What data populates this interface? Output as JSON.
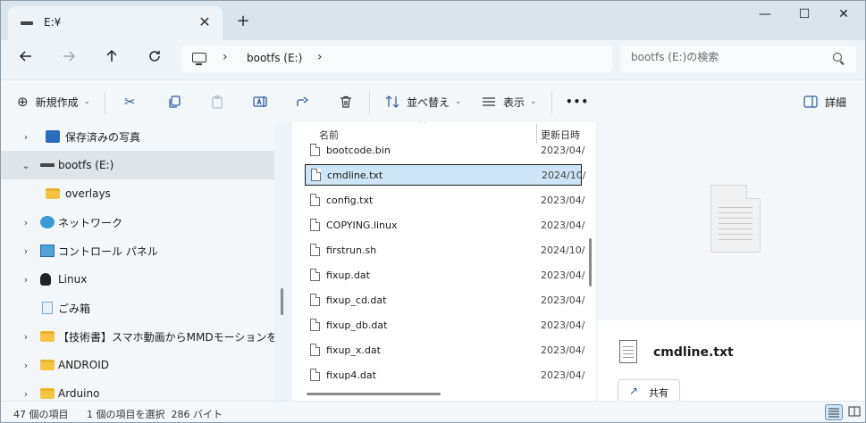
{
  "tab": {
    "title": "E:¥",
    "close_glyph": "✕",
    "new_glyph": "+"
  },
  "window": {
    "minimize": "—",
    "maximize": "☐",
    "close": "✕"
  },
  "address": {
    "crumb": "bootfs (E:)",
    "search_placeholder": "bootfs (E:)の検索"
  },
  "toolbar": {
    "new_label": "新規作成",
    "sort_label": "並べ替え",
    "view_label": "表示",
    "more_label": "•••",
    "details_label": "詳細"
  },
  "nav": {
    "items": [
      {
        "label": "保存済みの写真",
        "icon": "pictures-icon"
      },
      {
        "label": "bootfs (E:)",
        "icon": "drive-icon"
      },
      {
        "label": "overlays",
        "icon": "folder-icon"
      },
      {
        "label": "ネットワーク",
        "icon": "network-icon"
      },
      {
        "label": "コントロール パネル",
        "icon": "control-panel-icon"
      },
      {
        "label": "Linux",
        "icon": "linux-icon"
      },
      {
        "label": "ごみ箱",
        "icon": "recycle-bin-icon"
      },
      {
        "label": "【技術書】スマホ動画からMMDモーションを作る",
        "icon": "folder-icon"
      },
      {
        "label": "ANDROID",
        "icon": "folder-icon"
      },
      {
        "label": "Arduino",
        "icon": "folder-icon"
      }
    ]
  },
  "files": {
    "headers": {
      "name": "名前",
      "modified": "更新日時"
    },
    "rows": [
      {
        "name": "bootcode.bin",
        "date": "2023/04/"
      },
      {
        "name": "cmdline.txt",
        "date": "2024/10/"
      },
      {
        "name": "config.txt",
        "date": "2023/04/"
      },
      {
        "name": "COPYING.linux",
        "date": "2023/04/"
      },
      {
        "name": "firstrun.sh",
        "date": "2024/10/"
      },
      {
        "name": "fixup.dat",
        "date": "2023/04/"
      },
      {
        "name": "fixup_cd.dat",
        "date": "2023/04/"
      },
      {
        "name": "fixup_db.dat",
        "date": "2023/04/"
      },
      {
        "name": "fixup_x.dat",
        "date": "2023/04/"
      },
      {
        "name": "fixup4.dat",
        "date": "2023/04/"
      }
    ],
    "selected_index": 1
  },
  "details": {
    "file_name": "cmdline.txt",
    "share_label": "共有"
  },
  "status": {
    "item_count": "47 個の項目",
    "selection": "1 個の項目を選択  286 バイト"
  },
  "colors": {
    "accent": "#2c5a9e",
    "selection": "#cde5f7"
  }
}
